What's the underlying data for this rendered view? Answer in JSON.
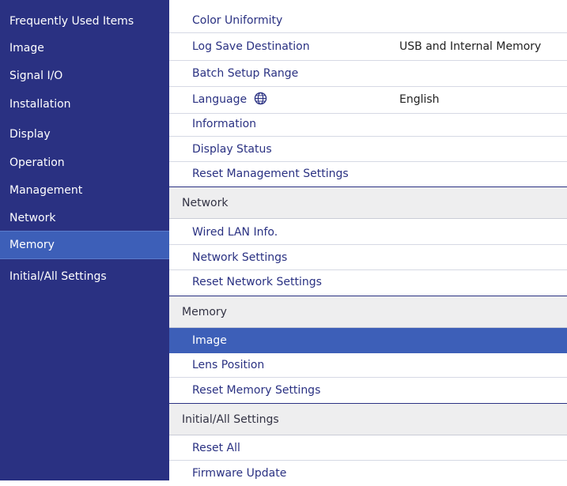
{
  "sidebar": {
    "items": [
      {
        "label": "Frequently Used Items"
      },
      {
        "label": "Image"
      },
      {
        "label": "Signal I/O"
      },
      {
        "label": "Installation"
      },
      {
        "label": "Display"
      },
      {
        "label": "Operation"
      },
      {
        "label": "Management"
      },
      {
        "label": "Network"
      },
      {
        "label": "Memory",
        "selected": true
      },
      {
        "label": "Initial/All Settings"
      }
    ]
  },
  "management": {
    "items": [
      {
        "label": "Color Uniformity"
      },
      {
        "label": "Log Save Destination",
        "value": "USB and Internal Memory"
      },
      {
        "label": "Batch Setup Range"
      },
      {
        "label": "Language",
        "icon": "globe-icon",
        "value": "English"
      },
      {
        "label": "Information"
      },
      {
        "label": "Display Status"
      },
      {
        "label": "Reset Management Settings"
      }
    ]
  },
  "network": {
    "header": "Network",
    "items": [
      {
        "label": "Wired LAN Info."
      },
      {
        "label": "Network Settings"
      },
      {
        "label": "Reset Network Settings"
      }
    ]
  },
  "memory": {
    "header": "Memory",
    "items": [
      {
        "label": "Image",
        "highlighted": true
      },
      {
        "label": "Lens Position"
      },
      {
        "label": "Reset Memory Settings"
      }
    ]
  },
  "initial": {
    "header": "Initial/All Settings",
    "items": [
      {
        "label": "Reset All"
      },
      {
        "label": "Firmware Update"
      }
    ]
  },
  "colors": {
    "sidebar_bg": "#2a3182",
    "selection_bg": "#3d5fb8",
    "item_text": "#2a3182",
    "section_bg": "#eeeeef"
  }
}
